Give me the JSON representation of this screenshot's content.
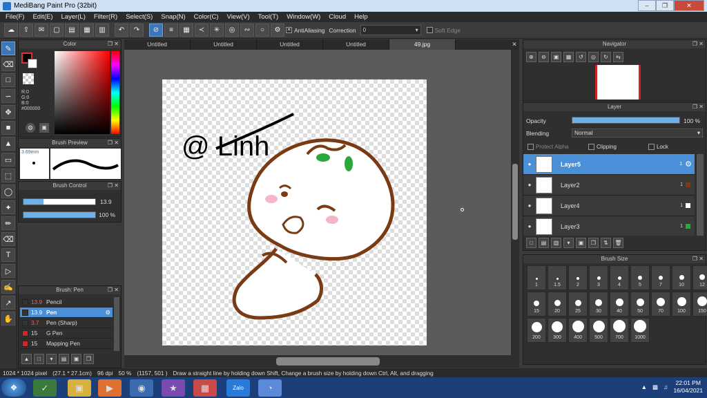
{
  "window": {
    "title": "MediBang Paint Pro (32bit)"
  },
  "menu": [
    "File(F)",
    "Edit(E)",
    "Layer(L)",
    "Filter(R)",
    "Select(S)",
    "Snap(N)",
    "Color(C)",
    "View(V)",
    "Tool(T)",
    "Window(W)",
    "Cloud",
    "Help"
  ],
  "toolbar": {
    "antialias_label": "AntiAliasing",
    "correction_label": "Correction",
    "correction_value": "0",
    "softedge_label": "Soft Edge"
  },
  "color_panel": {
    "title": "Color",
    "r": "R:0",
    "g": "G:0",
    "b": "B:0",
    "hex": "#000000"
  },
  "brush_preview": {
    "title": "Brush Preview",
    "size": "3.69mm"
  },
  "brush_control": {
    "title": "Brush Control",
    "size_value": "13.9",
    "opacity_value": "100 %",
    "size_fraction": 0.28,
    "opacity_fraction": 1.0
  },
  "brush_list": {
    "title": "Brush: Pen",
    "items": [
      {
        "size": "13.9",
        "name": "Pencil",
        "color": "#333333"
      },
      {
        "size": "13.9",
        "name": "Pen",
        "color": "#333333"
      },
      {
        "size": "3.7",
        "name": "Pen (Sharp)",
        "color": "#333333"
      },
      {
        "size": "15",
        "name": "G Pen",
        "color": "#e02020"
      },
      {
        "size": "15",
        "name": "Mapping Pen",
        "color": "#e02020"
      }
    ]
  },
  "tabs": [
    "Untitled",
    "Untitled",
    "Untitled",
    "Untitled",
    "49.jpg"
  ],
  "canvas": {
    "signature_text": "@ Linh"
  },
  "navigator": {
    "title": "Navigator"
  },
  "layer_panel": {
    "title": "Layer",
    "opacity_label": "Opacity",
    "opacity_value": "100 %",
    "opacity_fraction": 1.0,
    "blending_label": "Blending",
    "blending_value": "Normal",
    "protect_alpha": "Protect Alpha",
    "clipping": "Clipping",
    "lock": "Lock",
    "layers": [
      {
        "name": "Layer5",
        "num": "1"
      },
      {
        "name": "Layer2",
        "num": "1"
      },
      {
        "name": "Layer4",
        "num": "1"
      },
      {
        "name": "Layer3",
        "num": "1"
      }
    ]
  },
  "brush_size_panel": {
    "title": "Brush Size",
    "sizes": [
      "1",
      "1.5",
      "2",
      "3",
      "4",
      "5",
      "7",
      "10",
      "12",
      "15",
      "20",
      "25",
      "30",
      "40",
      "50",
      "70",
      "100",
      "150",
      "200",
      "300",
      "400",
      "500",
      "700",
      "1000"
    ]
  },
  "status": {
    "dims": "1024 * 1024 pixel",
    "cm": "(27.1 * 27.1cm)",
    "dpi": "96 dpi",
    "zoom": "50 %",
    "coord": "(1157, 501 )",
    "hint": "Draw a straight line by holding down Shift, Change a brush size by holding down Ctrl, Alt, and dragging"
  },
  "taskbar": {
    "time": "22:01 PM",
    "date": "16/04/2021",
    "zalo_label": "Zalo"
  }
}
